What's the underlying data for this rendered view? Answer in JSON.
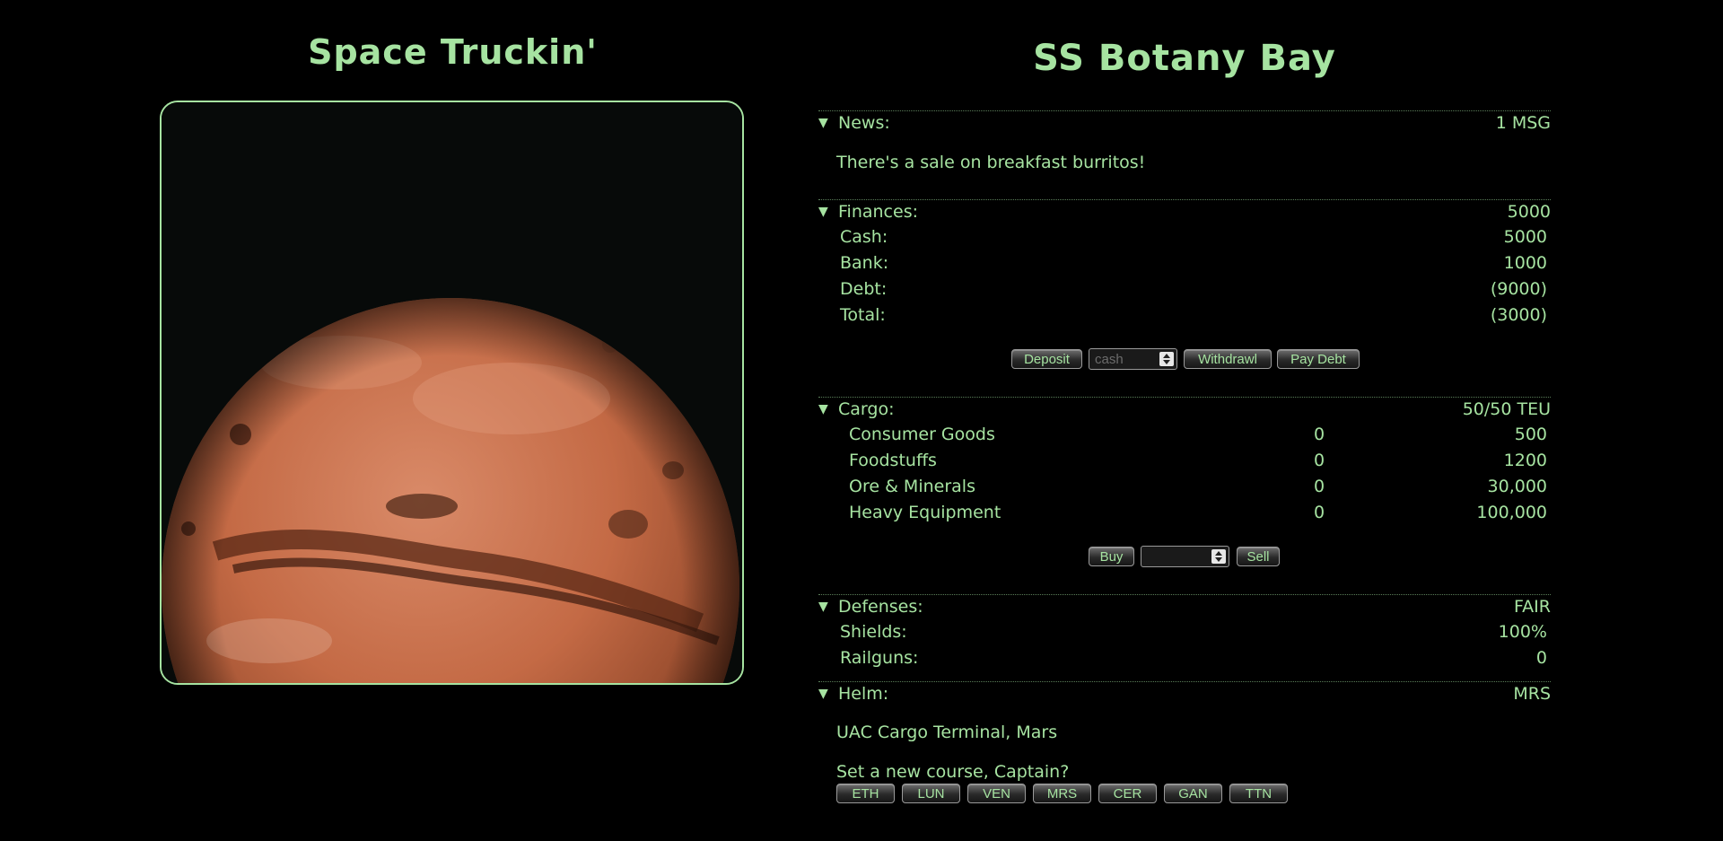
{
  "app": {
    "title": "Space Truckin'"
  },
  "ship": {
    "name": "SS Botany Bay"
  },
  "colors": {
    "accent": "#a6e3a1",
    "background": "#000000",
    "planet": "#c46a45"
  },
  "planet_image": {
    "icon": "mars-planet-image"
  },
  "news": {
    "label": "News:",
    "count": "1 MSG",
    "message": "There's a sale on breakfast burritos!"
  },
  "finances": {
    "label": "Finances:",
    "summary": "5000",
    "rows": [
      {
        "label": "Cash:",
        "value": "5000"
      },
      {
        "label": "Bank:",
        "value": "1000"
      },
      {
        "label": "Debt:",
        "value": "(9000)"
      },
      {
        "label": "Total:",
        "value": "(3000)"
      }
    ],
    "deposit_label": "Deposit",
    "amount_placeholder": "cash",
    "withdraw_label": "Withdrawl",
    "pay_debt_label": "Pay Debt"
  },
  "cargo": {
    "label": "Cargo:",
    "capacity": "50/50 TEU",
    "items": [
      {
        "name": "Consumer Goods",
        "qty": "0",
        "price": "500"
      },
      {
        "name": "Foodstuffs",
        "qty": "0",
        "price": "1200"
      },
      {
        "name": "Ore & Minerals",
        "qty": "0",
        "price": "30,000"
      },
      {
        "name": "Heavy Equipment",
        "qty": "0",
        "price": "100,000"
      }
    ],
    "buy_label": "Buy",
    "quantity_placeholder": "",
    "sell_label": "Sell"
  },
  "defenses": {
    "label": "Defenses:",
    "status": "FAIR",
    "rows": [
      {
        "label": "Shields:",
        "value": "100%"
      },
      {
        "label": "Railguns:",
        "value": "0"
      }
    ]
  },
  "helm": {
    "label": "Helm:",
    "location_code": "MRS",
    "location": "UAC Cargo Terminal, Mars",
    "prompt": "Set a new course, Captain?",
    "destinations": [
      "ETH",
      "LUN",
      "VEN",
      "MRS",
      "CER",
      "GAN",
      "TTN"
    ]
  }
}
